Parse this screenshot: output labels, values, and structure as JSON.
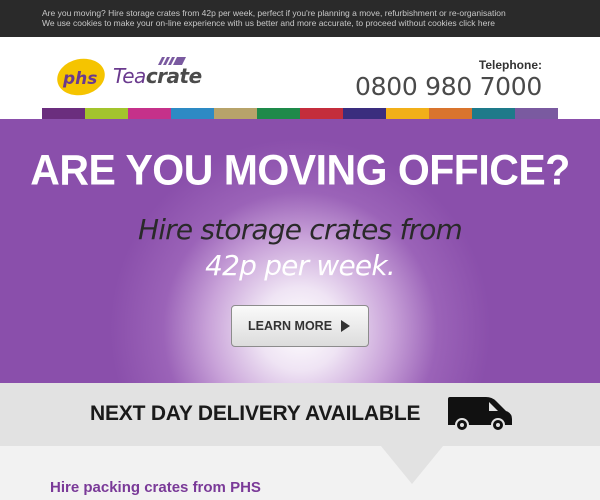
{
  "topbar": {
    "line1": "Are you moving? Hire storage crates from 42p per week, perfect if you're planning a move, refurbishment or re-organisation",
    "line2": "We use cookies to make your on-line experience with us better and more accurate, to proceed without cookies click here"
  },
  "header": {
    "logo_phs": "phs",
    "logo_tea": "Tea",
    "logo_crate": "crate",
    "telephone_label": "Telephone:",
    "telephone_number": "0800 980 7000"
  },
  "colors": {
    "brand_purple": "#8a4fab",
    "colorbar": [
      "#6b2e7e",
      "#a3c42d",
      "#c5318a",
      "#2d8ac4",
      "#b7a36a",
      "#1e8a4a",
      "#c42d3c",
      "#3a2d7e",
      "#f2b019",
      "#d9742d",
      "#1e7a8a",
      "#7a5aa0"
    ]
  },
  "hero": {
    "title": "ARE YOU MOVING OFFICE?",
    "subtitle_line1": "Hire storage crates from",
    "subtitle_line2": "42p per week.",
    "button_label": "LEARN MORE"
  },
  "delivery": {
    "text": "NEXT DAY DELIVERY AVAILABLE",
    "icon": "delivery-van-icon"
  },
  "lower": {
    "heading": "Hire packing crates from PHS"
  }
}
